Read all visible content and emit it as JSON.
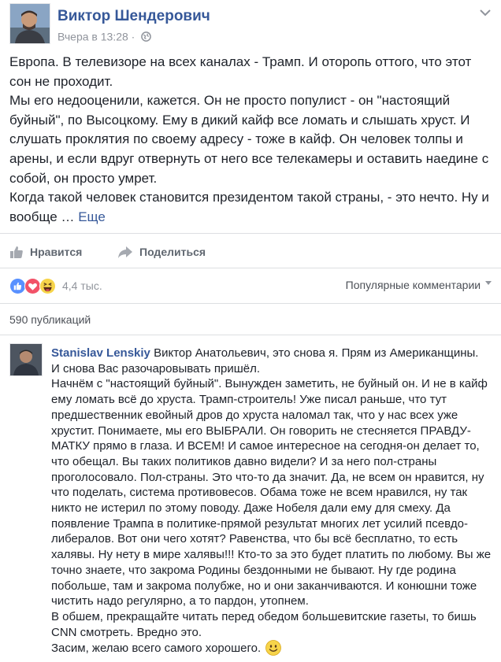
{
  "post": {
    "author": "Виктор Шендерович",
    "timestamp": "Вчера в 13:28",
    "separator": "·",
    "privacy_icon": "globe-icon",
    "paragraphs": [
      "Европа. В телевизоре на всех каналах - Трамп. И оторопь оттого, что этот сон не проходит.",
      "Мы его недооценили, кажется. Он не просто популист - он \"настоящий буйный\", по Высоцкому. Ему в дикий кайф все ломать и слышать хруст. И слушать проклятия по своему адресу - тоже в кайф. Он человек толпы и арены, и если вдруг отвернуть от него все телекамеры и оставить наедине с собой, он просто умрет.",
      "Когда такой человек становится президентом такой страны, - это нечто. Ну и вообще …"
    ],
    "see_more": "Еще"
  },
  "actions": {
    "like_label": "Нравится",
    "share_label": "Поделиться"
  },
  "reactions": {
    "icons": [
      "like-icon",
      "love-icon",
      "haha-icon"
    ],
    "count": "4,4 тыс.",
    "sort_label": "Популярные комментарии"
  },
  "shares": {
    "label": "590 публикаций"
  },
  "comment": {
    "author": "Stanislav Lenskiy",
    "lines": [
      "Виктор Анатольевич, это снова я. Прям из Американщины.",
      "И снова Вас разочаровывать пришёл.",
      "Начнём с \"настоящий буйный\". Вынужден заметить, не буйный он. И не в кайф ему ломать всё до хруста. Трамп-строитель! Уже писал раньше, что тут предшественник евойный дров до хруста наломал так, что у нас всех уже хрустит. Понимаете, мы его ВЫБРАЛИ. Он говорить не стесняется ПРАВДУ-МАТКУ прямо в глаза. И ВСЕМ! И самое интересное на сегодня-он делает то, что обещал. Вы таких политиков давно видели? И за него пол-страны проголосовало. Пол-страны. Это что-то да значит. Да, не всем он нравится, ну что поделать, система противовесов. Обама тоже не всем нравился, ну так никто не истерил по этому поводу. Даже Нобеля дали ему для смеху. Да появление Трампа в политике-прямой результат многих лет усилий псевдо-либералов. Вот они чего хотят? Равенства, что бы всё бесплатно, то есть халявы. Ну нету в мире халявы!!! Кто-то за это будет платить по любому. Вы же точно знаете, что закрома Родины бездонными не бывают. Ну где родина побольше, там и закрома полубже, но и они заканчиваются. И конюшни тоже чистить надо регулярно, а то пардон, утопнем.",
      "В обшем, прекращайте читать перед обедом большевитские газеты, то бишь CNN смотреть. Вредно это.",
      "Засим, желаю всего самого хорошего."
    ],
    "emoji_icon": "smiley-icon"
  },
  "colors": {
    "link": "#365899",
    "text": "#1d2129",
    "muted": "#90949c",
    "like_blue": "#5890ff",
    "love_red": "#f25268",
    "haha_yellow": "#f7d44a"
  }
}
